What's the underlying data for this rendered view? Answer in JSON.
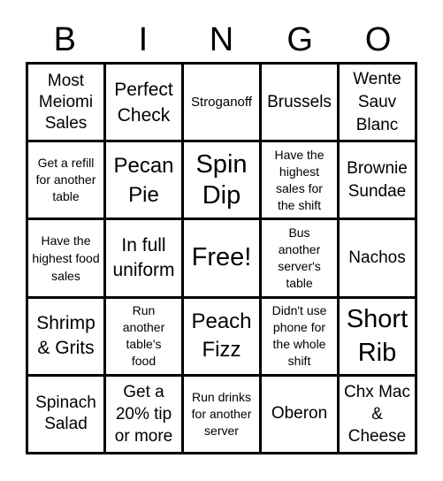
{
  "header": {
    "letters": [
      "B",
      "I",
      "N",
      "G",
      "O"
    ]
  },
  "cells": [
    "Most Meiomi Sales",
    "Perfect Check",
    "Stroganoff",
    "Brussels",
    "Wente Sauv Blanc",
    "Get a refill for another table",
    "Pecan Pie",
    "Spin Dip",
    "Have the highest sales for the shift",
    "Brownie Sundae",
    "Have the highest food sales",
    "In full uniform",
    "Free!",
    "Bus another server's table",
    "Nachos",
    "Shrimp & Grits",
    "Run another table's food",
    "Peach Fizz",
    "Didn't use phone for the whole shift",
    "Short Rib",
    "Spinach Salad",
    "Get a 20% tip or more",
    "Run drinks for another server",
    "Oberon",
    "Chx Mac & Cheese"
  ]
}
